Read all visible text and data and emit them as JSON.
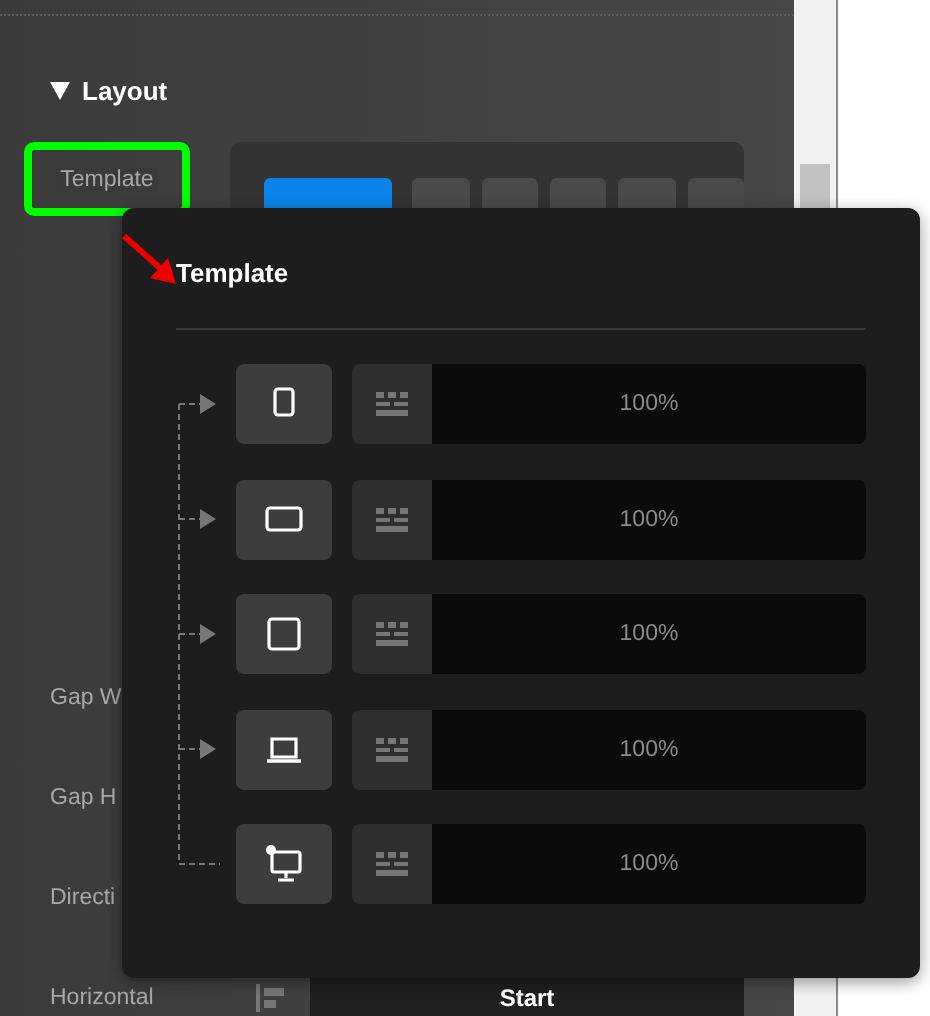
{
  "section": {
    "title": "Layout",
    "expanded": true
  },
  "template_field": {
    "label": "Template",
    "highlighted": true,
    "options": [
      {
        "selected": true
      },
      {
        "selected": false
      },
      {
        "selected": false
      },
      {
        "selected": false
      },
      {
        "selected": false
      },
      {
        "selected": false
      }
    ]
  },
  "fields": [
    {
      "label": "Gap W"
    },
    {
      "label": "Gap H"
    },
    {
      "label": "Directi"
    },
    {
      "label": "Horizontal",
      "value": "Start"
    }
  ],
  "popup": {
    "title": "Template",
    "rows": [
      {
        "kind": "phone",
        "value": "100%"
      },
      {
        "kind": "tablet",
        "value": "100%"
      },
      {
        "kind": "square",
        "value": "100%"
      },
      {
        "kind": "laptop",
        "value": "100%"
      },
      {
        "kind": "desktop",
        "value": "100%"
      }
    ]
  }
}
